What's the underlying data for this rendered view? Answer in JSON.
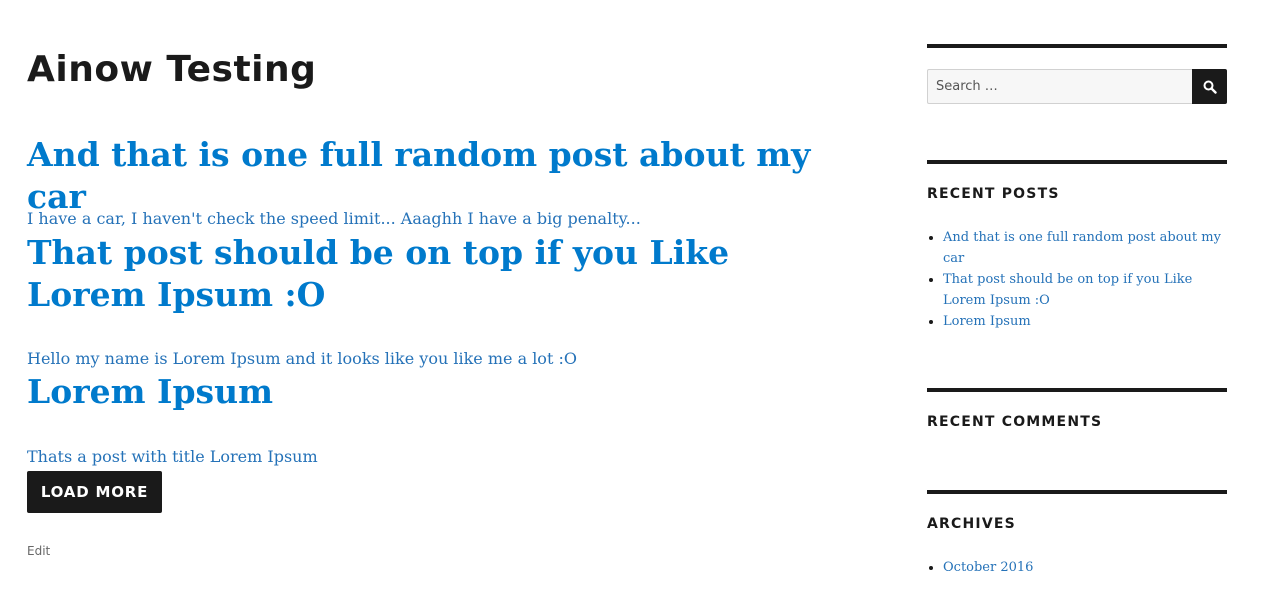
{
  "site": {
    "title": "Ainow Testing"
  },
  "posts": [
    {
      "title": "And that is one full random post about my car",
      "excerpt": "I have a car, I haven't check the speed limit... Aaaghh I have a big penalty..."
    },
    {
      "title": "That post should be on top if you Like Lorem Ipsum :O",
      "excerpt": "Hello my name is Lorem Ipsum and it looks like you like me a lot :O"
    },
    {
      "title": "Lorem Ipsum",
      "excerpt": "Thats a post with title Lorem Ipsum"
    }
  ],
  "actions": {
    "load_more_label": "LOAD MORE",
    "edit_label": "Edit"
  },
  "sidebar": {
    "search": {
      "placeholder": "Search …",
      "submit_icon": "search-icon"
    },
    "recent_posts": {
      "title": "RECENT POSTS",
      "items": [
        "And that is one full random post about my car",
        "That post should be on top if you Like Lorem Ipsum :O",
        "Lorem Ipsum"
      ]
    },
    "recent_comments": {
      "title": "RECENT COMMENTS"
    },
    "archives": {
      "title": "ARCHIVES",
      "items": [
        "October 2016"
      ]
    }
  },
  "colors": {
    "link": "#2572b8",
    "heading_link": "#007acc",
    "text": "#1a1a1a",
    "muted": "#686868",
    "button_bg": "#1a1a1a"
  }
}
